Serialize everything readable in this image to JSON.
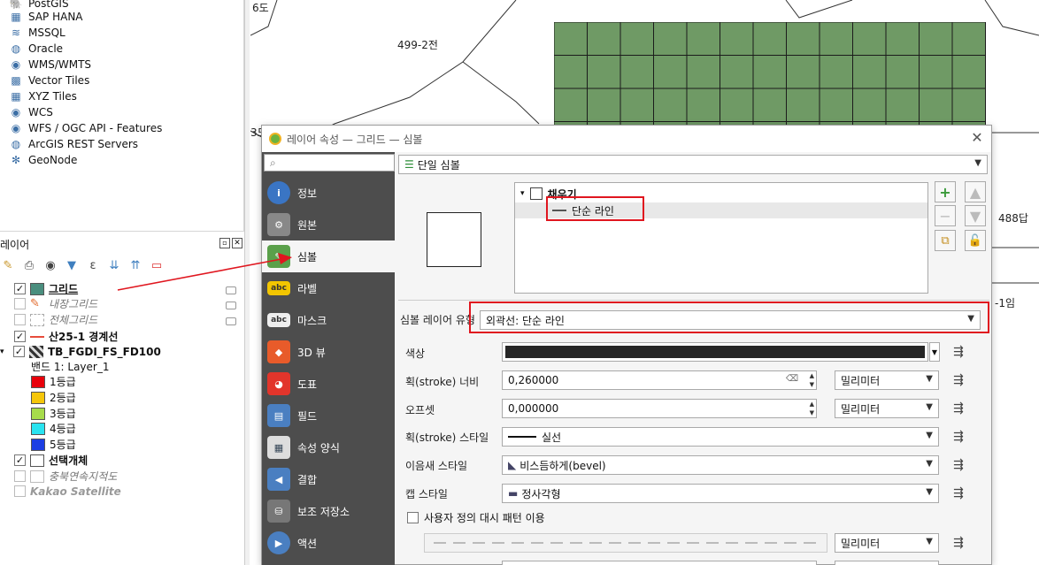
{
  "browser": {
    "items": [
      {
        "label": "PostGIS",
        "icon": "postgis-icon"
      },
      {
        "label": "SAP HANA",
        "icon": "sap-hana-icon"
      },
      {
        "label": "MSSQL",
        "icon": "mssql-icon"
      },
      {
        "label": "Oracle",
        "icon": "oracle-icon"
      },
      {
        "label": "WMS/WMTS",
        "icon": "wms-icon"
      },
      {
        "label": "Vector Tiles",
        "icon": "vector-tiles-icon"
      },
      {
        "label": "XYZ Tiles",
        "icon": "xyz-tiles-icon"
      },
      {
        "label": "WCS",
        "icon": "wcs-icon"
      },
      {
        "label": "WFS / OGC API - Features",
        "icon": "wfs-icon"
      },
      {
        "label": "ArcGIS REST Servers",
        "icon": "arcgis-icon"
      },
      {
        "label": "GeoNode",
        "icon": "geonode-icon"
      }
    ]
  },
  "layers": {
    "title": "레이어",
    "rows": [
      {
        "label": "그리드",
        "checked": true,
        "swatch": "#4a8e7e"
      },
      {
        "label": "내장그리드",
        "checked": false
      },
      {
        "label": "전체그리드",
        "checked": false
      },
      {
        "label": "산25-1 경계선",
        "checked": true,
        "line_color": "#e74c3c"
      },
      {
        "label": "TB_FGDI_FS_FD100",
        "checked": true
      },
      {
        "label": "밴드 1: Layer_1"
      },
      {
        "label": "1등급",
        "swatch": "#e8000b"
      },
      {
        "label": "2등급",
        "swatch": "#f5c60a"
      },
      {
        "label": "3등급",
        "swatch": "#a7dc4b"
      },
      {
        "label": "4등급",
        "swatch": "#29e3f0"
      },
      {
        "label": "5등급",
        "swatch": "#1c3ee3"
      },
      {
        "label": "선택개체",
        "checked": true
      },
      {
        "label": "충북연속지적도",
        "checked": false
      },
      {
        "label": "Kakao Satellite",
        "checked": false
      }
    ]
  },
  "map": {
    "labels": [
      "6도",
      "499-2전",
      "3도",
      "488답",
      "-1임"
    ],
    "grid_color": "#6f9a65"
  },
  "dialog": {
    "title": "레이어 속성 — 그리드 — 심볼",
    "nav": [
      {
        "label": "정보"
      },
      {
        "label": "원본"
      },
      {
        "label": "심볼"
      },
      {
        "label": "라벨"
      },
      {
        "label": "마스크"
      },
      {
        "label": "3D 뷰"
      },
      {
        "label": "도표"
      },
      {
        "label": "필드"
      },
      {
        "label": "속성 양식"
      },
      {
        "label": "결합"
      },
      {
        "label": "보조 저장소"
      },
      {
        "label": "액션"
      }
    ],
    "renderer": "단일 심볼",
    "tree": {
      "fill": "채우기",
      "line": "단순 라인"
    },
    "symbol_layer_type_label": "심볼 레이어 유형",
    "symbol_layer_type": "외곽선: 단순 라인",
    "fields": {
      "color_label": "색상",
      "color_value": "#262626",
      "stroke_width_label": "획(stroke) 너비",
      "stroke_width": "0,260000",
      "stroke_width_unit": "밀리미터",
      "offset_label": "오프셋",
      "offset": "0,000000",
      "offset_unit": "밀리미터",
      "stroke_style_label": "획(stroke) 스타일",
      "stroke_style": "실선",
      "join_style_label": "이음새 스타일",
      "join_style": "비스듬하게(bevel)",
      "cap_style_label": "캡 스타일",
      "cap_style": "정사각형",
      "custom_dash_label": "사용자 정의 대시 패턴 이용",
      "dash_unit": "밀리미터"
    }
  }
}
